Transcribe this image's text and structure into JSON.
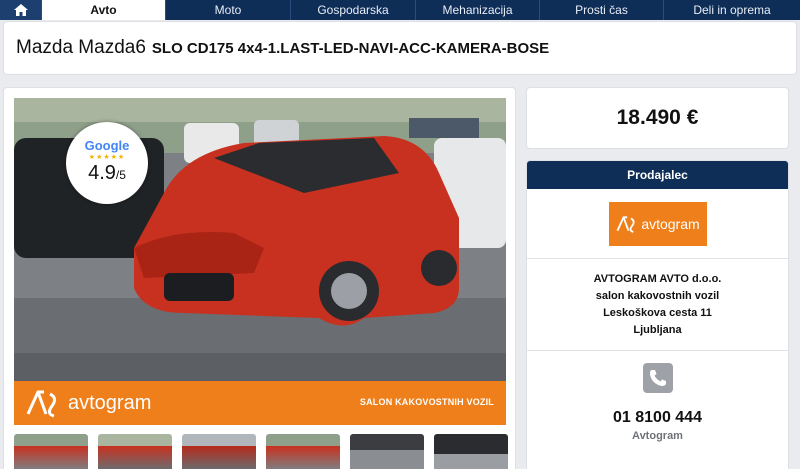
{
  "nav": {
    "home_icon": "home-icon",
    "tabs": [
      {
        "label": "Avto",
        "active": true
      },
      {
        "label": "Moto"
      },
      {
        "label": "Gospodarska"
      },
      {
        "label": "Mehanizacija"
      },
      {
        "label": "Prosti čas"
      },
      {
        "label": "Deli in oprema"
      }
    ]
  },
  "listing": {
    "title_make": "Mazda Mazda6",
    "title_sub": "SLO CD175 4x4-1.LAST-LED-NAVI-ACC-KAMERA-BOSE"
  },
  "photo": {
    "banner_logo": "avtogram",
    "banner_slogan": "SALON KAKOVOSTNIH VOZIL",
    "google_badge": {
      "brand": "Google",
      "stars": "★★★★★",
      "rating": "4.9",
      "scale": "/5"
    },
    "thumbnail_count": 6
  },
  "price": "18.490 €",
  "seller": {
    "header": "Prodajalec",
    "logo_text": "avtogram",
    "company": "AVTOGRAM AVTO d.o.o.",
    "tagline": "salon kakovostnih vozil",
    "street": "Leskoškova cesta 11",
    "city": "Ljubljana",
    "phone_icon": "phone-icon",
    "phone": "01 8100 444",
    "contact_name": "Avtogram"
  },
  "colors": {
    "nav_bg": "#0e2d57",
    "brand_orange": "#ef7f1a",
    "page_bg": "#e9ebee"
  }
}
